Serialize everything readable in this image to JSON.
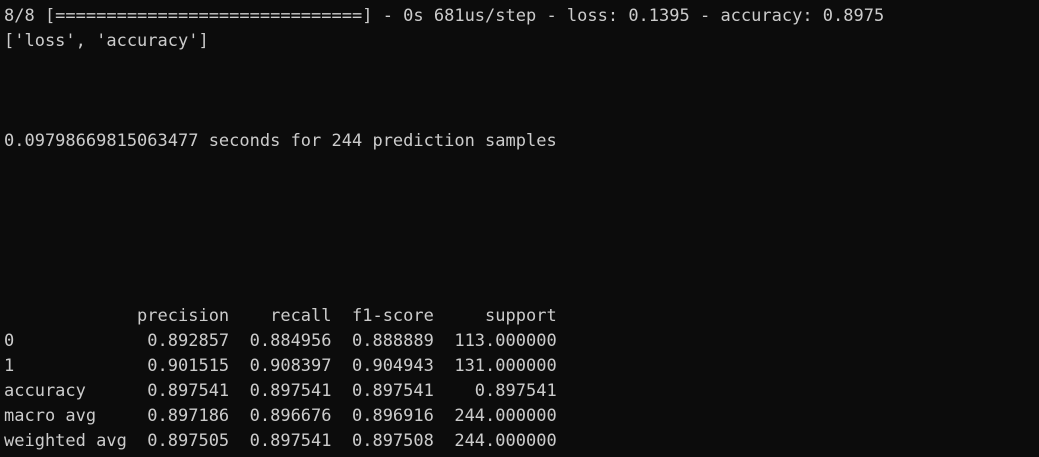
{
  "terminal": {
    "background": "#0c0c0c",
    "foreground": "#cccccc",
    "progress_line": "8/8 [==============================] - 0s 681us/step - loss: 0.1395 - accuracy: 0.8975",
    "metrics_names_line": "['loss', 'accuracy']",
    "timing_line": "0.09798669815063477 seconds for 244 prediction samples",
    "report": {
      "header_line": "             precision    recall  f1-score     support",
      "rows": [
        "0             0.892857  0.884956  0.888889  113.000000",
        "1             0.901515  0.908397  0.904943  131.000000",
        "accuracy      0.897541  0.897541  0.897541    0.897541",
        "macro avg     0.897186  0.896676  0.896916  244.000000",
        "weighted avg  0.897505  0.897541  0.897508  244.000000"
      ]
    }
  }
}
